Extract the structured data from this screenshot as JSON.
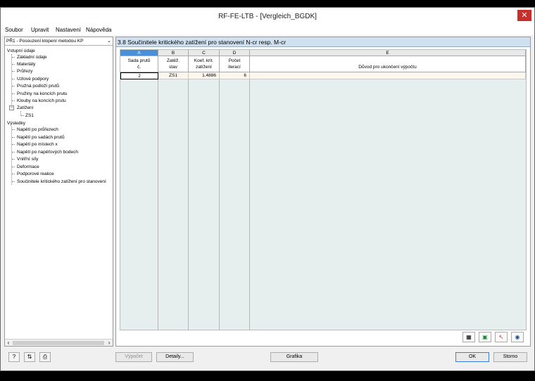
{
  "window": {
    "title": "RF-FE-LTB - [Vergleich_BGDK]",
    "close_glyph": "✕"
  },
  "menu": {
    "items": [
      "Soubor",
      "Upravit",
      "Nastavení",
      "Nápověda"
    ]
  },
  "left_panel": {
    "module_select": "PŘ1 - Posouzení klopení metodou KP",
    "tree": {
      "input_header": "Vstupní údaje",
      "input_items": [
        "Základní údaje",
        "Materiály",
        "Průřezy",
        "Uzlové podpory",
        "Pružná podloží prutů",
        "Pružiny na koncích prutu",
        "Klouby na koncích prutu"
      ],
      "loads_label": "Zatížení",
      "loads_child": "ZS1",
      "results_header": "Výsledky",
      "results_items": [
        "Napětí po průřezech",
        "Napětí po sadách prutů",
        "Napětí po místech x",
        "Napětí po napěťových bodech",
        "Vnitřní síly",
        "Deformace",
        "Podporové reakce",
        "Součinitele kritického zatížení pro stanovení"
      ]
    }
  },
  "table": {
    "title": "3.8 Součinitele kritického zatížení pro stanovení N-cr resp. M-cr",
    "columns": [
      {
        "letter": "A",
        "header": "Sada prutů\nč."
      },
      {
        "letter": "B",
        "header": "Zatěž.\nstav"
      },
      {
        "letter": "C",
        "header": "Koef. krit.\nzatížení"
      },
      {
        "letter": "D",
        "header": "Počet\niterací"
      },
      {
        "letter": "E",
        "header": "Důvod pro ukončení výpočtu"
      }
    ],
    "rows": [
      {
        "a": "2",
        "b": "ZS1",
        "c": "1.4886",
        "d": "6",
        "e": ""
      }
    ]
  },
  "buttons": {
    "calculate": "Výpočet",
    "details": "Detaily...",
    "graphics": "Grafika",
    "ok": "OK",
    "cancel": "Storno"
  }
}
